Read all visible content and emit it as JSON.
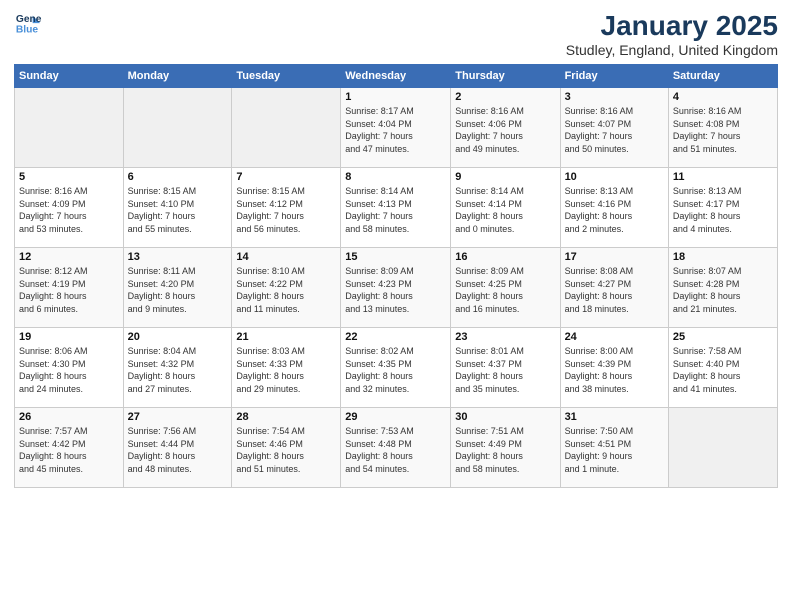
{
  "logo": {
    "line1": "General",
    "line2": "Blue"
  },
  "title": "January 2025",
  "subtitle": "Studley, England, United Kingdom",
  "weekdays": [
    "Sunday",
    "Monday",
    "Tuesday",
    "Wednesday",
    "Thursday",
    "Friday",
    "Saturday"
  ],
  "weeks": [
    [
      {
        "day": "",
        "detail": ""
      },
      {
        "day": "",
        "detail": ""
      },
      {
        "day": "",
        "detail": ""
      },
      {
        "day": "1",
        "detail": "Sunrise: 8:17 AM\nSunset: 4:04 PM\nDaylight: 7 hours\nand 47 minutes."
      },
      {
        "day": "2",
        "detail": "Sunrise: 8:16 AM\nSunset: 4:06 PM\nDaylight: 7 hours\nand 49 minutes."
      },
      {
        "day": "3",
        "detail": "Sunrise: 8:16 AM\nSunset: 4:07 PM\nDaylight: 7 hours\nand 50 minutes."
      },
      {
        "day": "4",
        "detail": "Sunrise: 8:16 AM\nSunset: 4:08 PM\nDaylight: 7 hours\nand 51 minutes."
      }
    ],
    [
      {
        "day": "5",
        "detail": "Sunrise: 8:16 AM\nSunset: 4:09 PM\nDaylight: 7 hours\nand 53 minutes."
      },
      {
        "day": "6",
        "detail": "Sunrise: 8:15 AM\nSunset: 4:10 PM\nDaylight: 7 hours\nand 55 minutes."
      },
      {
        "day": "7",
        "detail": "Sunrise: 8:15 AM\nSunset: 4:12 PM\nDaylight: 7 hours\nand 56 minutes."
      },
      {
        "day": "8",
        "detail": "Sunrise: 8:14 AM\nSunset: 4:13 PM\nDaylight: 7 hours\nand 58 minutes."
      },
      {
        "day": "9",
        "detail": "Sunrise: 8:14 AM\nSunset: 4:14 PM\nDaylight: 8 hours\nand 0 minutes."
      },
      {
        "day": "10",
        "detail": "Sunrise: 8:13 AM\nSunset: 4:16 PM\nDaylight: 8 hours\nand 2 minutes."
      },
      {
        "day": "11",
        "detail": "Sunrise: 8:13 AM\nSunset: 4:17 PM\nDaylight: 8 hours\nand 4 minutes."
      }
    ],
    [
      {
        "day": "12",
        "detail": "Sunrise: 8:12 AM\nSunset: 4:19 PM\nDaylight: 8 hours\nand 6 minutes."
      },
      {
        "day": "13",
        "detail": "Sunrise: 8:11 AM\nSunset: 4:20 PM\nDaylight: 8 hours\nand 9 minutes."
      },
      {
        "day": "14",
        "detail": "Sunrise: 8:10 AM\nSunset: 4:22 PM\nDaylight: 8 hours\nand 11 minutes."
      },
      {
        "day": "15",
        "detail": "Sunrise: 8:09 AM\nSunset: 4:23 PM\nDaylight: 8 hours\nand 13 minutes."
      },
      {
        "day": "16",
        "detail": "Sunrise: 8:09 AM\nSunset: 4:25 PM\nDaylight: 8 hours\nand 16 minutes."
      },
      {
        "day": "17",
        "detail": "Sunrise: 8:08 AM\nSunset: 4:27 PM\nDaylight: 8 hours\nand 18 minutes."
      },
      {
        "day": "18",
        "detail": "Sunrise: 8:07 AM\nSunset: 4:28 PM\nDaylight: 8 hours\nand 21 minutes."
      }
    ],
    [
      {
        "day": "19",
        "detail": "Sunrise: 8:06 AM\nSunset: 4:30 PM\nDaylight: 8 hours\nand 24 minutes."
      },
      {
        "day": "20",
        "detail": "Sunrise: 8:04 AM\nSunset: 4:32 PM\nDaylight: 8 hours\nand 27 minutes."
      },
      {
        "day": "21",
        "detail": "Sunrise: 8:03 AM\nSunset: 4:33 PM\nDaylight: 8 hours\nand 29 minutes."
      },
      {
        "day": "22",
        "detail": "Sunrise: 8:02 AM\nSunset: 4:35 PM\nDaylight: 8 hours\nand 32 minutes."
      },
      {
        "day": "23",
        "detail": "Sunrise: 8:01 AM\nSunset: 4:37 PM\nDaylight: 8 hours\nand 35 minutes."
      },
      {
        "day": "24",
        "detail": "Sunrise: 8:00 AM\nSunset: 4:39 PM\nDaylight: 8 hours\nand 38 minutes."
      },
      {
        "day": "25",
        "detail": "Sunrise: 7:58 AM\nSunset: 4:40 PM\nDaylight: 8 hours\nand 41 minutes."
      }
    ],
    [
      {
        "day": "26",
        "detail": "Sunrise: 7:57 AM\nSunset: 4:42 PM\nDaylight: 8 hours\nand 45 minutes."
      },
      {
        "day": "27",
        "detail": "Sunrise: 7:56 AM\nSunset: 4:44 PM\nDaylight: 8 hours\nand 48 minutes."
      },
      {
        "day": "28",
        "detail": "Sunrise: 7:54 AM\nSunset: 4:46 PM\nDaylight: 8 hours\nand 51 minutes."
      },
      {
        "day": "29",
        "detail": "Sunrise: 7:53 AM\nSunset: 4:48 PM\nDaylight: 8 hours\nand 54 minutes."
      },
      {
        "day": "30",
        "detail": "Sunrise: 7:51 AM\nSunset: 4:49 PM\nDaylight: 8 hours\nand 58 minutes."
      },
      {
        "day": "31",
        "detail": "Sunrise: 7:50 AM\nSunset: 4:51 PM\nDaylight: 9 hours\nand 1 minute."
      },
      {
        "day": "",
        "detail": ""
      }
    ]
  ]
}
